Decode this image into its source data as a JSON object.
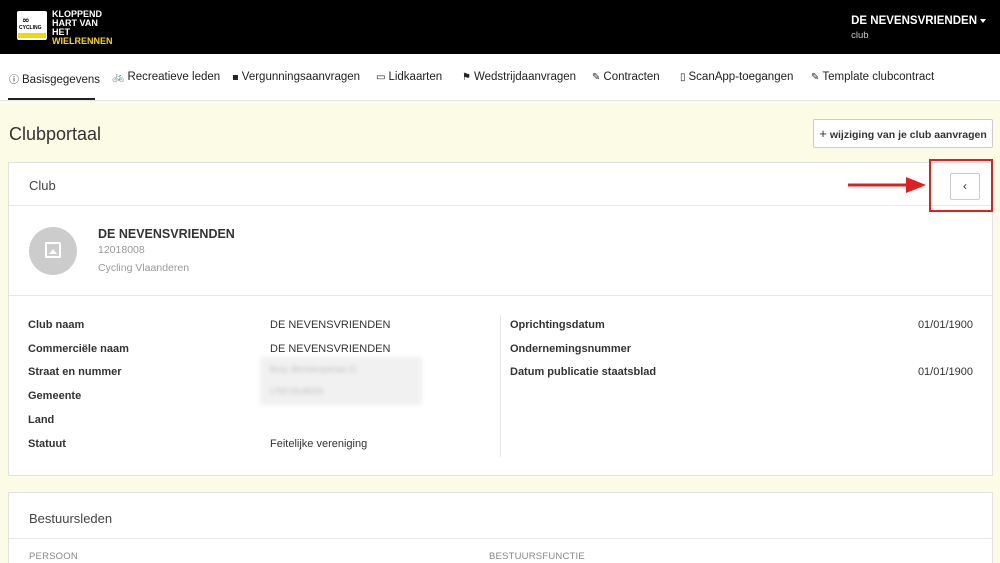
{
  "brand": {
    "line1": "KLOPPEND",
    "line2": "HART VAN HET",
    "line3": "WIELRENNEN",
    "badge": "CYCLING",
    "badge_sub": "VLAANDEREN"
  },
  "user": {
    "name": "DE NEVENSVRIENDEN",
    "role": "club"
  },
  "tabs": [
    {
      "label": "Basisgegevens",
      "icon": "info-icon"
    },
    {
      "label": "Recreatieve leden",
      "icon": "bicycle-icon"
    },
    {
      "label": "Vergunningsaanvragen",
      "icon": "id-badge-icon"
    },
    {
      "label": "Lidkaarten",
      "icon": "card-icon"
    },
    {
      "label": "Wedstrijdaanvragen",
      "icon": "checkered-flag-icon"
    },
    {
      "label": "Contracten",
      "icon": "signature-icon"
    },
    {
      "label": "ScanApp-toegangen",
      "icon": "mobile-icon"
    },
    {
      "label": "Template clubcontract",
      "icon": "signature-icon"
    }
  ],
  "page": {
    "title": "Clubportaal",
    "request_button": "wijziging van je club aanvragen"
  },
  "club_panel": {
    "title": "Club",
    "collapse_symbol": "‹",
    "name": "DE NEVENSVRIENDEN",
    "number": "12018008",
    "federation": "Cycling Vlaanderen",
    "labels": {
      "club_naam": "Club naam",
      "commerciele_naam": "Commerciële naam",
      "straat": "Straat en nummer",
      "gemeente": "Gemeente",
      "land": "Land",
      "statuut": "Statuut",
      "oprichtingsdatum": "Oprichtingsdatum",
      "ondernemingsnummer": "Ondernemingsnummer",
      "publicatie": "Datum publicatie staatsblad"
    },
    "values": {
      "club_naam": "DE NEVENSVRIENDEN",
      "commerciele_naam": "DE NEVENSVRIENDEN",
      "straat": "Burg. Blombergstraat 21",
      "gemeente": "1700 DILBEEK",
      "statuut": "Feitelijke vereniging",
      "oprichtingsdatum": "01/01/1900",
      "publicatie": "01/01/1900"
    }
  },
  "bestuur_panel": {
    "title": "Bestuursleden",
    "col_persoon": "PERSOON",
    "col_functie": "BESTUURSFUNCTIE"
  },
  "colors": {
    "topbar": "#000000",
    "brand_yellow": "#f5d800",
    "background": "#fbfbe6",
    "highlight": "#e02020"
  }
}
